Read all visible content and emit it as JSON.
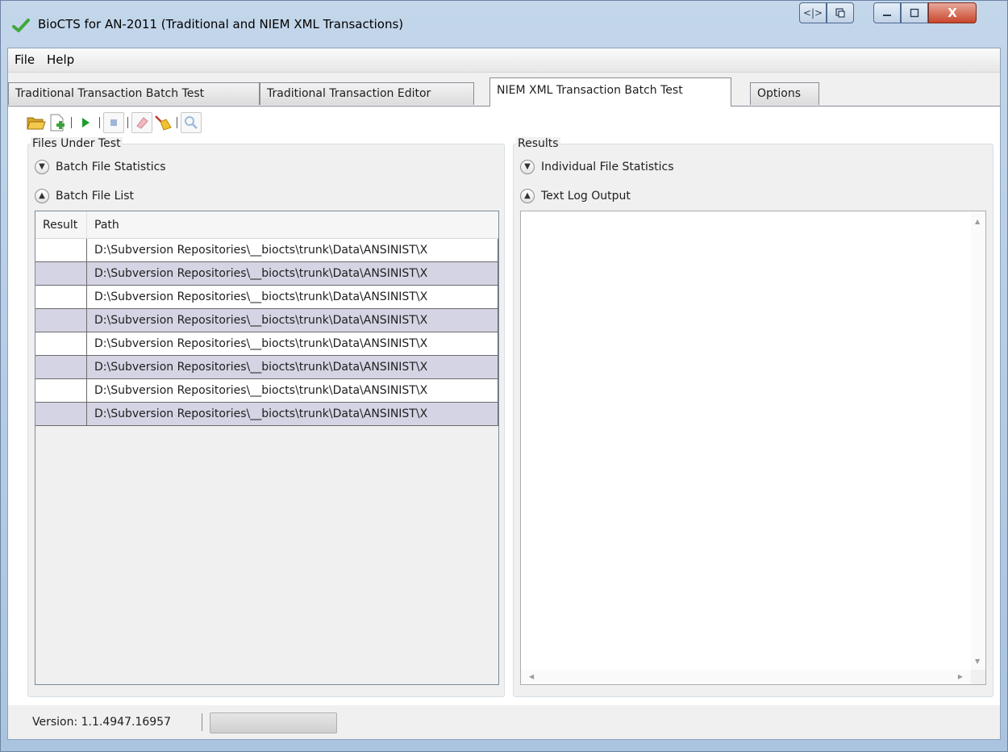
{
  "window": {
    "title": "BioCTS for AN-2011 (Traditional and NIEM XML Transactions)",
    "icon": "green-checkmark-icon",
    "controls": {
      "close_glyph": "X"
    }
  },
  "menu": {
    "items": [
      "File",
      "Help"
    ]
  },
  "tabs": [
    {
      "label": "Traditional Transaction Batch Test",
      "active": false
    },
    {
      "label": "Traditional Transaction Editor",
      "active": false
    },
    {
      "label": "NIEM XML Transaction Batch Test",
      "active": true
    },
    {
      "label": "Options",
      "active": false
    }
  ],
  "toolbar": {
    "buttons": [
      "open-folder-icon",
      "add-file-icon",
      "run-icon",
      "stop-icon",
      "eraser-icon",
      "broom-icon",
      "search-icon"
    ]
  },
  "files_under_test": {
    "title": "Files Under Test",
    "expanders": [
      {
        "label": "Batch File Statistics",
        "expanded": false
      },
      {
        "label": "Batch File List",
        "expanded": true
      }
    ],
    "grid": {
      "columns": [
        "Result",
        "Path"
      ],
      "rows": [
        {
          "result": "",
          "path": "D:\\Subversion Repositories\\__biocts\\trunk\\Data\\ANSINIST\\X"
        },
        {
          "result": "",
          "path": "D:\\Subversion Repositories\\__biocts\\trunk\\Data\\ANSINIST\\X"
        },
        {
          "result": "",
          "path": "D:\\Subversion Repositories\\__biocts\\trunk\\Data\\ANSINIST\\X"
        },
        {
          "result": "",
          "path": "D:\\Subversion Repositories\\__biocts\\trunk\\Data\\ANSINIST\\X"
        },
        {
          "result": "",
          "path": "D:\\Subversion Repositories\\__biocts\\trunk\\Data\\ANSINIST\\X"
        },
        {
          "result": "",
          "path": "D:\\Subversion Repositories\\__biocts\\trunk\\Data\\ANSINIST\\X"
        },
        {
          "result": "",
          "path": "D:\\Subversion Repositories\\__biocts\\trunk\\Data\\ANSINIST\\X"
        },
        {
          "result": "",
          "path": "D:\\Subversion Repositories\\__biocts\\trunk\\Data\\ANSINIST\\X"
        }
      ]
    }
  },
  "results": {
    "title": "Results",
    "expanders": [
      {
        "label": "Individual File Statistics",
        "expanded": false
      },
      {
        "label": "Text Log Output",
        "expanded": true
      }
    ],
    "log_text": ""
  },
  "status": {
    "version": "Version: 1.1.4947.16957",
    "progress": 0
  }
}
